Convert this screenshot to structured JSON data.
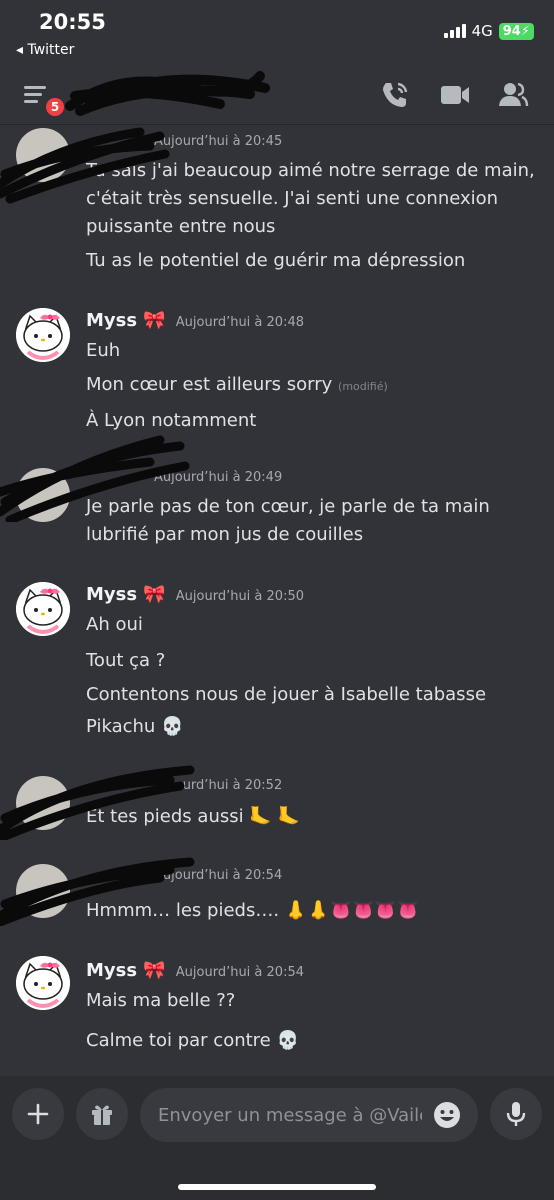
{
  "status_bar": {
    "time": "20:55",
    "back_app": "◂ Twitter",
    "network": "4G",
    "battery": "94"
  },
  "header": {
    "notification_count": "5"
  },
  "messages": [
    {
      "author": "",
      "timestamp": "Aujourd’hui à 20:45",
      "lines": [
        "Tu sais j'ai beaucoup aimé notre serrage de main,",
        "c'était très sensuelle. J'ai senti une connexion",
        "puissante entre nous",
        "Tu as le potentiel de guérir ma dépression"
      ]
    },
    {
      "author": "Myss 🎀",
      "timestamp": "Aujourd’hui à 20:48",
      "lines": [
        "Euh",
        "Mon cœur est ailleurs sorry",
        "À Lyon notamment"
      ],
      "edited_label": "(modifié)"
    },
    {
      "author": "",
      "timestamp": "Aujourd’hui à 20:49",
      "lines": [
        "Je parle pas de ton cœur, je parle de ta main",
        "lubrifié par mon jus de couilles"
      ]
    },
    {
      "author": "Myss 🎀",
      "timestamp": "Aujourd’hui à 20:50",
      "lines": [
        "Ah oui",
        "Tout ça ?",
        "Contentons nous de jouer à Isabelle tabasse",
        "Pikachu 💀"
      ]
    },
    {
      "author": "",
      "timestamp": "Aujourd’hui à 20:52",
      "lines": [
        "Et tes pieds aussi 🦶 🦶"
      ]
    },
    {
      "author": "",
      "timestamp": "Aujourd’hui à 20:54",
      "lines": [
        "Hmmm… les pieds…. 👃👃👅👅👅👅"
      ]
    },
    {
      "author": "Myss 🎀",
      "timestamp": "Aujourd’hui à 20:54",
      "lines": [
        "Mais ma belle ??",
        "Calme toi par contre 💀"
      ]
    }
  ],
  "composer": {
    "placeholder": "Envoyer un message à @Vaile"
  },
  "colors": {
    "background": "#313338",
    "composer_background": "#2b2d31",
    "badge": "#f23f43",
    "battery": "#4cd964"
  },
  "icons": [
    "menu-icon",
    "phone-call-icon",
    "video-camera-icon",
    "members-icon",
    "plus-icon",
    "gift-icon",
    "emoji-icon",
    "microphone-icon",
    "skull-emoji",
    "bow-emoji"
  ]
}
